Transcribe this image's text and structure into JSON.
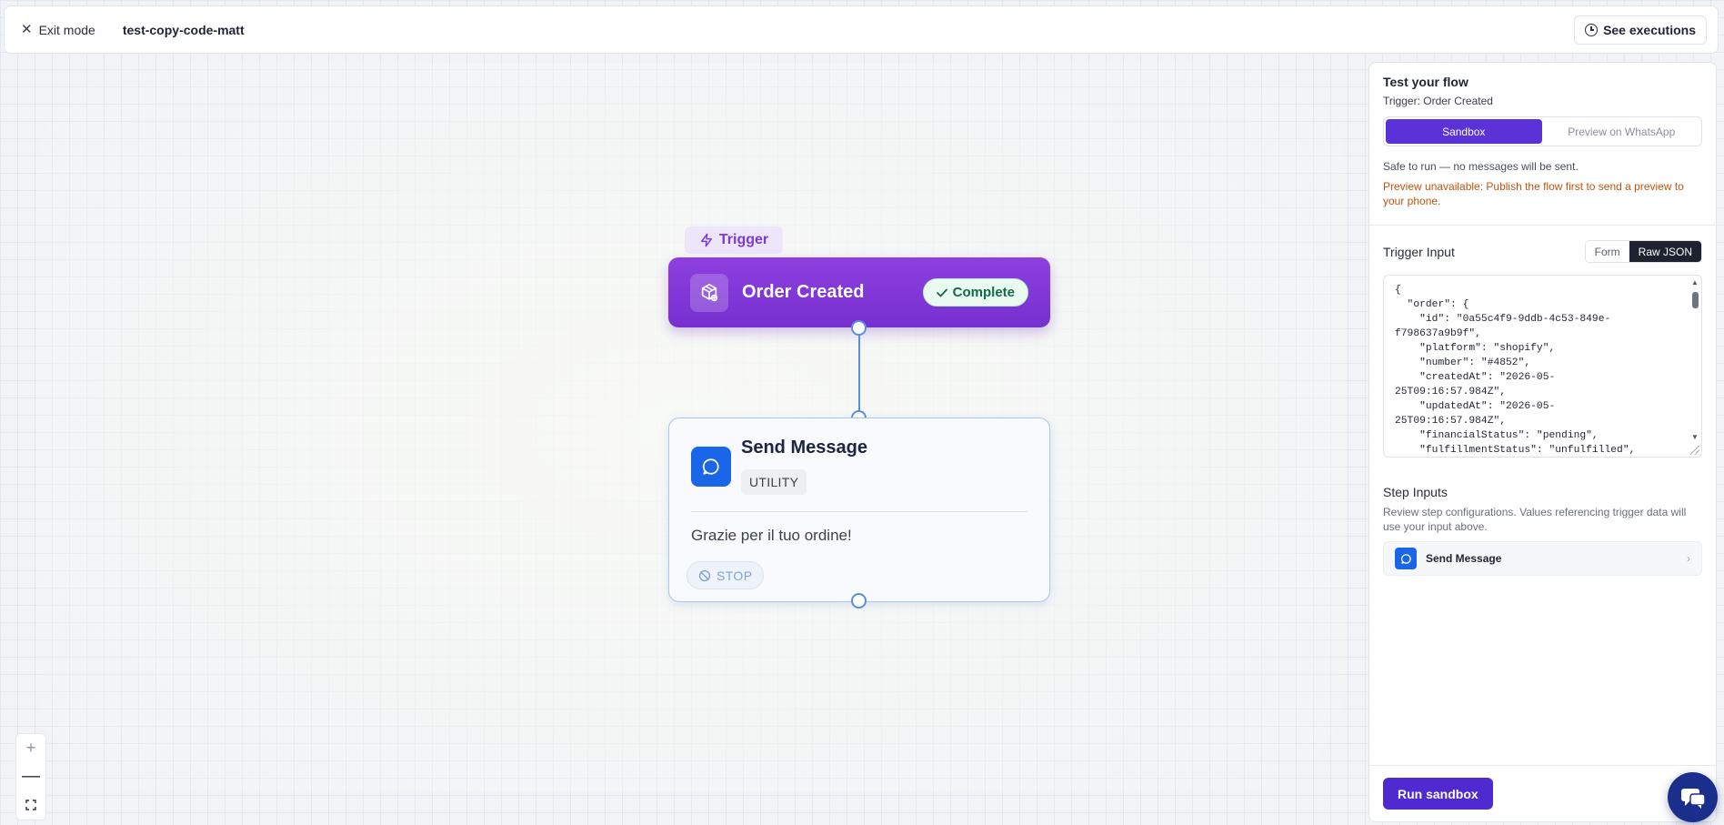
{
  "topbar": {
    "exit_label": "Exit mode",
    "flow_name": "test-copy-code-matt",
    "see_executions_label": "See executions"
  },
  "canvas": {
    "trigger_label": "Trigger",
    "trigger_node": {
      "title": "Order Created",
      "status": "Complete",
      "accent_color": "#7a34d4"
    },
    "message_node": {
      "title": "Send Message",
      "category": "UTILITY",
      "text": "Grazie per il tuo ordine!",
      "end_badge": "STOP",
      "accent_color": "#1a66e8"
    }
  },
  "panel": {
    "title": "Test your flow",
    "subtitle": "Trigger: Order Created",
    "modes": [
      "Sandbox",
      "Preview on WhatsApp"
    ],
    "active_mode": "Sandbox",
    "safe_note": "Safe to run — no messages will be sent.",
    "warning": "Preview unavailable: Publish the flow first to send a preview to your phone.",
    "trigger_input": {
      "title": "Trigger Input",
      "tabs": [
        "Form",
        "Raw JSON"
      ],
      "active_tab": "Raw JSON",
      "json_text": "{\n  \"order\": {\n    \"id\": \"0a55c4f9-9ddb-4c53-849e-\nf798637a9b9f\",\n    \"platform\": \"shopify\",\n    \"number\": \"#4852\",\n    \"createdAt\": \"2026-05-\n25T09:16:57.984Z\",\n    \"updatedAt\": \"2026-05-\n25T09:16:57.984Z\",\n    \"financialStatus\": \"pending\",\n    \"fulfillmentStatus\": \"unfulfilled\","
    },
    "step_inputs": {
      "title": "Step Inputs",
      "description": "Review step configurations. Values referencing trigger data will use your input above.",
      "items": [
        {
          "label": "Send Message"
        }
      ]
    },
    "run_label": "Run sandbox",
    "brand_color": "#4f2ad0"
  },
  "icons": {
    "exit": "close-icon",
    "executions": "clock-icon",
    "trigger": "bolt-icon",
    "trigger_node": "package-icon",
    "message_node": "chat-bubble-icon",
    "status": "check-icon",
    "stop": "ban-icon",
    "step_chevron": "chevron-right-icon",
    "support": "chat-support-icon"
  }
}
